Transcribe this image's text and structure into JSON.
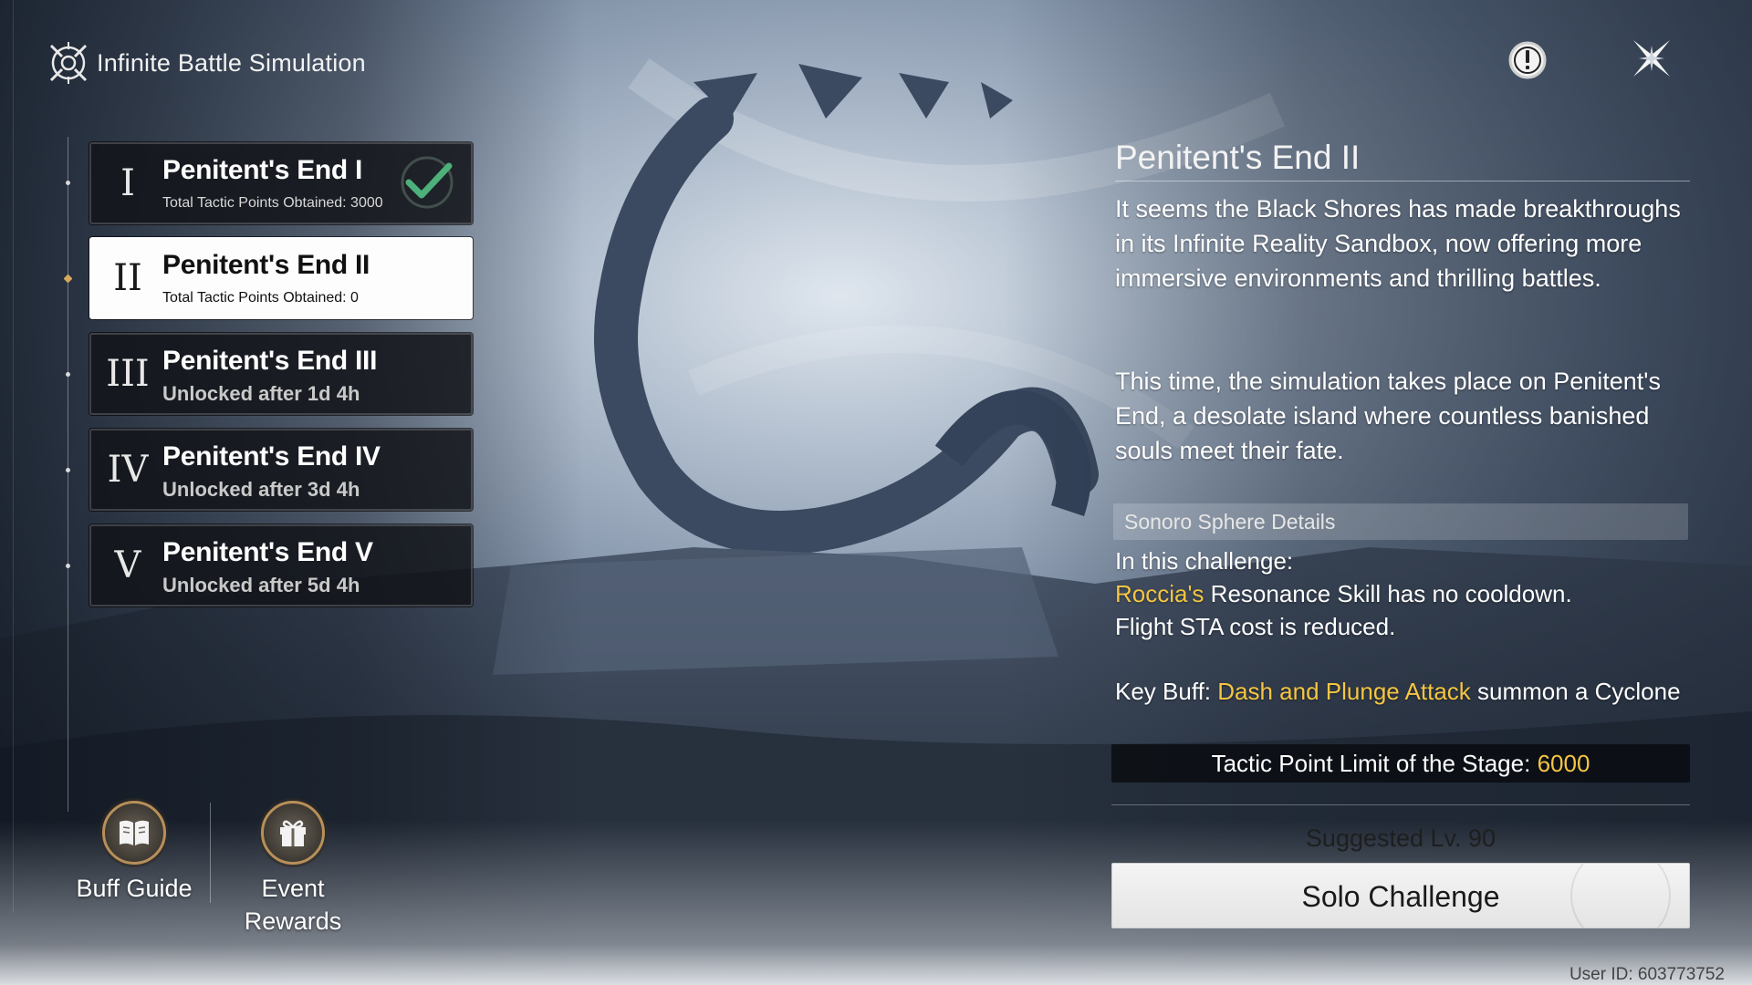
{
  "header": {
    "title": "Infinite Battle Simulation",
    "logo_icon": "simulation-emblem-icon",
    "info_icon": "exclamation-circle-icon",
    "close_icon": "close-x-icon"
  },
  "stages": [
    {
      "numeral": "I",
      "name": "Penitent's End I",
      "subtitle": "Total Tactic Points Obtained: 3000",
      "completed": true,
      "selected": false
    },
    {
      "numeral": "II",
      "name": "Penitent's End II",
      "subtitle": "Total Tactic Points Obtained: 0",
      "completed": false,
      "selected": true
    },
    {
      "numeral": "III",
      "name": "Penitent's End III",
      "subtitle": "Unlocked after 1d 4h",
      "completed": false,
      "selected": false
    },
    {
      "numeral": "IV",
      "name": "Penitent's End IV",
      "subtitle": "Unlocked after 3d 4h",
      "completed": false,
      "selected": false
    },
    {
      "numeral": "V",
      "name": "Penitent's End V",
      "subtitle": "Unlocked after 5d 4h",
      "completed": false,
      "selected": false
    }
  ],
  "bottom_buttons": {
    "buff_guide": {
      "label": "Buff Guide",
      "icon": "book-icon"
    },
    "event_rewards": {
      "label": "Event Rewards",
      "icon": "gift-icon"
    }
  },
  "detail": {
    "title": "Penitent's End II",
    "paragraph1": "It seems the Black Shores has made breakthroughs in its Infinite Reality Sandbox, now offering more immersive environments and thrilling battles.",
    "paragraph2": "This time, the simulation takes place on Penitent's End, a desolate island where countless banished souls meet their fate.",
    "sphere_header": "Sonoro Sphere Details",
    "challenge_intro": "In this challenge:",
    "challenge_name": "Roccia's",
    "challenge_rest": " Resonance Skill has no cooldown.",
    "challenge_line2": "Flight STA cost is reduced.",
    "key_buff_prefix": "Key Buff: ",
    "key_buff_highlight": "Dash and Plunge Attack",
    "key_buff_rest": " summon a Cyclone",
    "limit_label": "Tactic Point Limit of the Stage: ",
    "limit_value": "6000",
    "suggested": "Suggested Lv. 90",
    "solo_button": "Solo Challenge"
  },
  "footer": {
    "user_id": "User ID: 603773752"
  },
  "colors": {
    "highlight": "#f5c542",
    "accent_gold": "#b88f5a",
    "panel_dark": "#121418",
    "selected_bg": "#fdfdfd"
  }
}
